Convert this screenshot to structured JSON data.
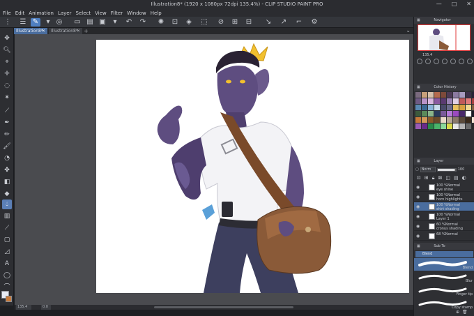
{
  "window": {
    "title": "Illustration8* (1920 x 1080px 72dpi 135.4%) - CLIP STUDIO PAINT PRO",
    "controls": [
      "—",
      "□",
      "✕"
    ]
  },
  "menu": [
    "File",
    "Edit",
    "Animation",
    "Layer",
    "Select",
    "View",
    "Filter",
    "Window",
    "Help"
  ],
  "tabs": [
    {
      "label": "Illustration8*",
      "active": true
    },
    {
      "label": "Illustration8*",
      "active": false
    }
  ],
  "tab_add": "+",
  "tools": [
    "move-icon",
    "zoom-icon",
    "object-icon",
    "lasso-icon",
    "auto-select-icon",
    "eyedropper-icon",
    "pen-icon",
    "pencil-icon",
    "brush-icon",
    "airbrush-icon",
    "decoration-icon",
    "eraser-icon",
    "fill-icon",
    "blend-icon",
    "gradient-icon",
    "figure-icon",
    "frame-icon",
    "ruler-icon",
    "text-icon",
    "balloon-icon",
    "correct-line-icon"
  ],
  "status": {
    "zoom": "135.4",
    "angle": "0.0"
  },
  "navigator": {
    "title": "Navigator",
    "zoom": "135.4"
  },
  "color_history": {
    "title": "Color History",
    "colors": [
      "#7a6a7e",
      "#c8a07a",
      "#d6c0aa",
      "#b46b4e",
      "#7d4a3a",
      "#4d3a55",
      "#8b7aa0",
      "#a89cc0",
      "#3c3048",
      "#2a2236",
      "#6e5a84",
      "#b894c8",
      "#d9b8e0",
      "#8a5aa0",
      "#5a3a70",
      "#9a82b4",
      "#e0d0e6",
      "#c05a5a",
      "#e07a7a",
      "#a64040",
      "#5a8ab4",
      "#3a6a94",
      "#8ab4d8",
      "#c8dcec",
      "#4a4a6a",
      "#6a6a8a",
      "#e8c060",
      "#d8a040",
      "#f0d890",
      "#806040",
      "#3c5a3c",
      "#5a8a5a",
      "#8ab48a",
      "#2a3a5a",
      "#7a5a9a",
      "#b47ad8",
      "#9a4ac0",
      "#4a2a6a",
      "#ffffff",
      "#1a1a24",
      "#c87a3a",
      "#d49a5a",
      "#8a5a2a",
      "#6a4a2a",
      "#e8d8c8",
      "#b8a898",
      "#8a7a6a",
      "#5a4a3a",
      "#3a2a1a",
      "#f0e0d0",
      "#9a5ab4",
      "#6a2a8a",
      "#2a8a4a",
      "#4ab46a",
      "#8ad89a",
      "#d8d84a",
      "#e8e8e8",
      "#b4b4b4",
      "#6a6a6a",
      "#2a2a2a"
    ]
  },
  "layer_panel": {
    "title": "Layer",
    "blend_mode": "Norm",
    "opacity": "100",
    "layers": [
      {
        "opacity": "100 %Normal",
        "name": "eye shine",
        "selected": false
      },
      {
        "opacity": "100 %Normal",
        "name": "horn highlights",
        "selected": false
      },
      {
        "opacity": "100 %Normal",
        "name": "shirt shading",
        "selected": true
      },
      {
        "opacity": "100 %Normal",
        "name": "Layer 1",
        "selected": false
      },
      {
        "opacity": "60 %Normal",
        "name": "cronus shading",
        "selected": false
      },
      {
        "opacity": "68 %Normal",
        "name": "",
        "selected": false
      }
    ]
  },
  "subtool": {
    "title": "Sub To",
    "group": "Blend",
    "brushes": [
      {
        "name": "Blend",
        "selected": true
      },
      {
        "name": "Blur",
        "selected": false
      },
      {
        "name": "Finger tip",
        "selected": false
      },
      {
        "name": "Copy stamp",
        "selected": false
      }
    ]
  }
}
